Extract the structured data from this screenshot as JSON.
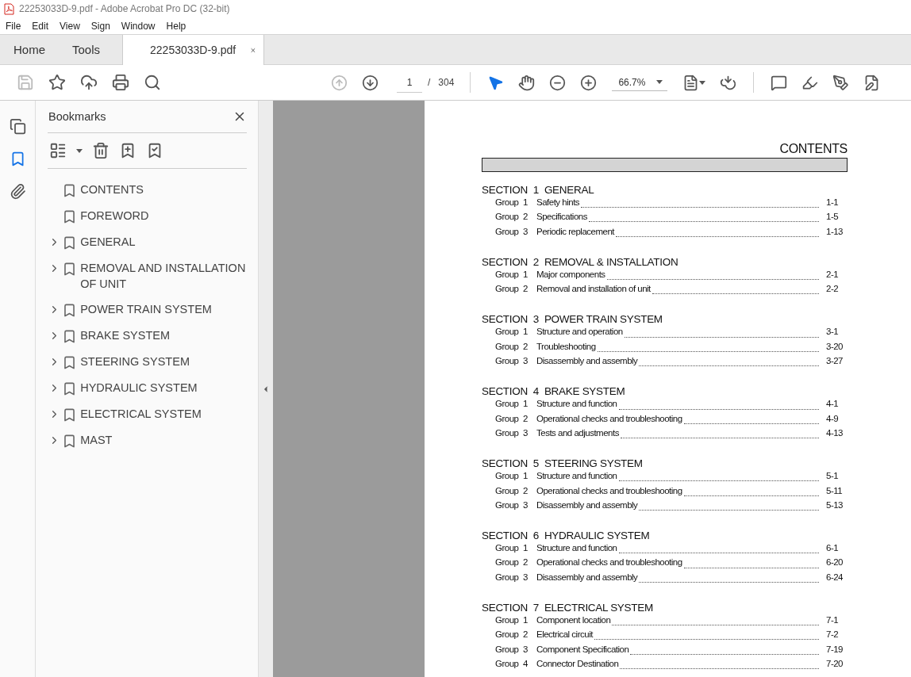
{
  "window": {
    "title": "22253033D-9.pdf - Adobe Acrobat Pro DC (32-bit)"
  },
  "menu": [
    "File",
    "Edit",
    "View",
    "Sign",
    "Window",
    "Help"
  ],
  "tabs": [
    {
      "label": "Home",
      "selected": false,
      "kind": "nav"
    },
    {
      "label": "Tools",
      "selected": false,
      "kind": "nav"
    },
    {
      "label": "22253033D-9.pdf",
      "selected": true,
      "kind": "document"
    }
  ],
  "toolbar": {
    "left": [
      {
        "kind": "save",
        "disabled": true
      },
      {
        "kind": "star",
        "disabled": false
      },
      {
        "kind": "upload",
        "disabled": false
      },
      {
        "kind": "print",
        "disabled": false
      },
      {
        "kind": "search",
        "disabled": false
      }
    ],
    "navigation": [
      {
        "kind": "previous",
        "disabled": true
      },
      {
        "kind": "next",
        "disabled": false
      }
    ],
    "page_value": "1",
    "page_separator": "/",
    "page_count": "304",
    "tools": [
      {
        "kind": "select",
        "selected": true
      },
      {
        "kind": "hand",
        "selected": false
      }
    ],
    "zoom_tools": [
      {
        "kind": "zoom-out",
        "disabled": false
      },
      {
        "kind": "zoom-in",
        "disabled": false
      }
    ],
    "zoom_value": "66.7%",
    "right": [
      {
        "kind": "fit"
      },
      {
        "kind": "read"
      },
      {
        "kind": "divider"
      },
      {
        "kind": "comment"
      },
      {
        "kind": "highlight"
      },
      {
        "kind": "sign"
      },
      {
        "kind": "edit"
      }
    ]
  },
  "rail": [
    {
      "kind": "pages",
      "selected": false
    },
    {
      "kind": "bookmarks",
      "selected": true
    },
    {
      "kind": "attachments",
      "selected": false
    }
  ],
  "bookmarks": {
    "title": "Bookmarks",
    "items": [
      {
        "label": "CONTENTS",
        "kind": "leaf"
      },
      {
        "label": "FOREWORD",
        "kind": "leaf"
      },
      {
        "label": "GENERAL",
        "kind": "folder"
      },
      {
        "label": "REMOVAL AND INSTALLATION OF UNIT",
        "kind": "folder"
      },
      {
        "label": "POWER TRAIN SYSTEM",
        "kind": "folder"
      },
      {
        "label": "BRAKE SYSTEM",
        "kind": "folder"
      },
      {
        "label": "STEERING SYSTEM",
        "kind": "folder"
      },
      {
        "label": "HYDRAULIC SYSTEM",
        "kind": "folder"
      },
      {
        "label": "ELECTRICAL SYSTEM",
        "kind": "folder"
      },
      {
        "label": "MAST",
        "kind": "folder"
      }
    ]
  },
  "document": {
    "heading": "CONTENTS",
    "sections": [
      {
        "title": "SECTION  1  GENERAL",
        "groups": [
          {
            "label": "Group",
            "number": "1",
            "title": "Safety hints",
            "page": "1-1"
          },
          {
            "label": "Group",
            "number": "2",
            "title": "Specifications",
            "page": "1-5"
          },
          {
            "label": "Group",
            "number": "3",
            "title": "Periodic replacement",
            "page": "1-13"
          }
        ]
      },
      {
        "title": "SECTION  2  REMOVAL & INSTALLATION",
        "groups": [
          {
            "label": "Group",
            "number": "1",
            "title": "Major components",
            "page": "2-1"
          },
          {
            "label": "Group",
            "number": "2",
            "title": "Removal and installation of unit",
            "page": "2-2"
          }
        ]
      },
      {
        "title": "SECTION  3  POWER TRAIN SYSTEM",
        "groups": [
          {
            "label": "Group",
            "number": "1",
            "title": "Structure and operation",
            "page": "3-1"
          },
          {
            "label": "Group",
            "number": "2",
            "title": "Troubleshooting",
            "page": "3-20"
          },
          {
            "label": "Group",
            "number": "3",
            "title": "Disassembly and assembly",
            "page": "3-27"
          }
        ]
      },
      {
        "title": "SECTION  4  BRAKE SYSTEM",
        "groups": [
          {
            "label": "Group",
            "number": "1",
            "title": "Structure and function",
            "page": "4-1"
          },
          {
            "label": "Group",
            "number": "2",
            "title": "Operational checks and troubleshooting",
            "page": "4-9"
          },
          {
            "label": "Group",
            "number": "3",
            "title": "Tests and adjustments",
            "page": "4-13"
          }
        ]
      },
      {
        "title": "SECTION  5  STEERING SYSTEM",
        "groups": [
          {
            "label": "Group",
            "number": "1",
            "title": "Structure and function",
            "page": "5-1"
          },
          {
            "label": "Group",
            "number": "2",
            "title": "Operational checks and troubleshooting",
            "page": "5-11"
          },
          {
            "label": "Group",
            "number": "3",
            "title": "Disassembly and assembly",
            "page": "5-13"
          }
        ]
      },
      {
        "title": "SECTION  6  HYDRAULIC SYSTEM",
        "groups": [
          {
            "label": "Group",
            "number": "1",
            "title": "Structure and function",
            "page": "6-1"
          },
          {
            "label": "Group",
            "number": "2",
            "title": "Operational checks and troubleshooting",
            "page": "6-20"
          },
          {
            "label": "Group",
            "number": "3",
            "title": "Disassembly and assembly",
            "page": "6-24"
          }
        ]
      },
      {
        "title": "SECTION  7  ELECTRICAL SYSTEM",
        "groups": [
          {
            "label": "Group",
            "number": "1",
            "title": "Component location",
            "page": "7-1"
          },
          {
            "label": "Group",
            "number": "2",
            "title": "Electrical circuit",
            "page": "7-2"
          },
          {
            "label": "Group",
            "number": "3",
            "title": "Component Specification",
            "page": "7-19"
          },
          {
            "label": "Group",
            "number": "4",
            "title": "Connector Destination",
            "page": "7-20"
          }
        ]
      }
    ]
  }
}
